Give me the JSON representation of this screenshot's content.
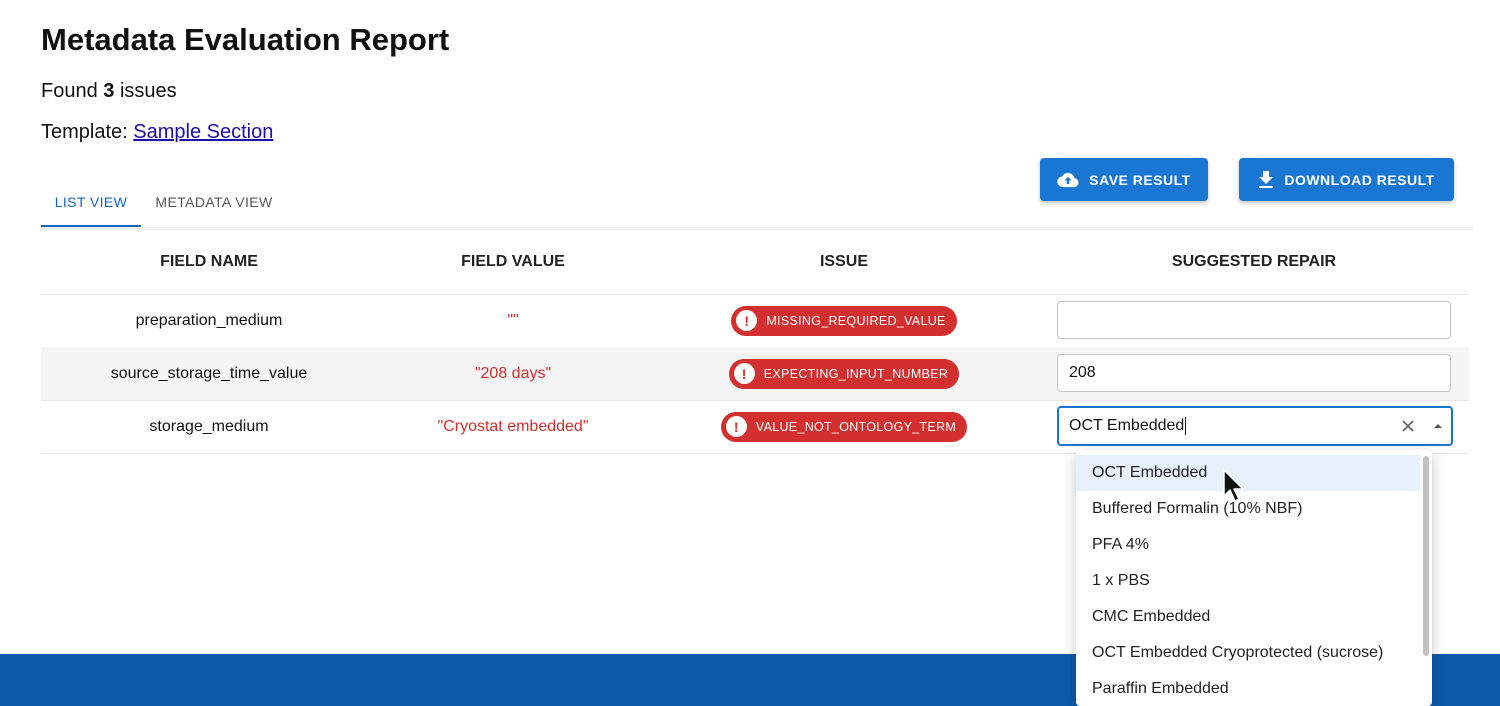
{
  "header": {
    "title": "Metadata Evaluation Report",
    "found_prefix": "Found",
    "issue_count": "3",
    "found_suffix": "issues",
    "template_label": "Template:",
    "template_link": "Sample Section"
  },
  "tabs": [
    {
      "label": "LIST VIEW",
      "active": true
    },
    {
      "label": "METADATA VIEW",
      "active": false
    }
  ],
  "actions": {
    "save_label": "SAVE RESULT",
    "download_label": "DOWNLOAD RESULT",
    "save_icon": "cloud-upload-icon",
    "download_icon": "download-icon"
  },
  "table": {
    "columns": [
      "FIELD NAME",
      "FIELD VALUE",
      "ISSUE",
      "SUGGESTED REPAIR"
    ],
    "rows": [
      {
        "field_name": "preparation_medium",
        "field_value": "\"\"",
        "issue": "MISSING_REQUIRED_VALUE",
        "repair": ""
      },
      {
        "field_name": "source_storage_time_value",
        "field_value": "\"208 days\"",
        "issue": "EXPECTING_INPUT_NUMBER",
        "repair": "208"
      },
      {
        "field_name": "storage_medium",
        "field_value": "\"Cryostat embedded\"",
        "issue": "VALUE_NOT_ONTOLOGY_TERM",
        "repair": "OCT Embedded"
      }
    ]
  },
  "dropdown": {
    "options": [
      "OCT Embedded",
      "Buffered Formalin (10% NBF)",
      "PFA 4%",
      "1 x PBS",
      "CMC Embedded",
      "OCT Embedded Cryoprotected (sucrose)",
      "Paraffin Embedded"
    ],
    "highlighted": "OCT Embedded"
  },
  "colors": {
    "primary": "#1976d2",
    "error": "#d32f2f",
    "footer": "#0d5aab"
  }
}
